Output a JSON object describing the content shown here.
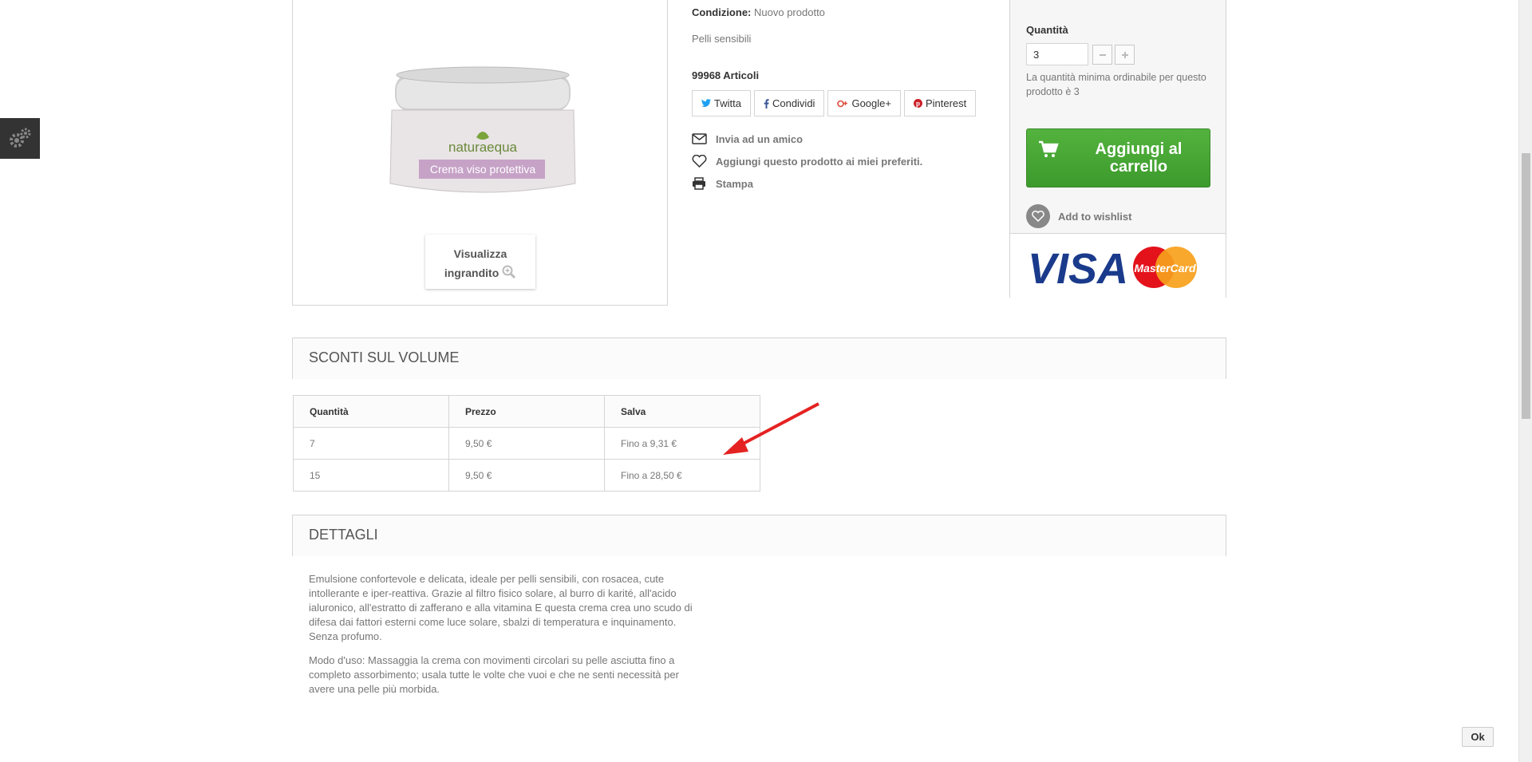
{
  "product": {
    "condition_label": "Condizione:",
    "condition_value": "Nuovo prodotto",
    "skin_type": "Pelli sensibili",
    "stock": "99968 Articoli",
    "jar_brand": "naturaequa",
    "jar_label": "Crema viso protettiva",
    "zoom_label_1": "Visualizza",
    "zoom_label_2": "ingrandito"
  },
  "social": [
    {
      "label": "Twitta",
      "icon": "twitter-icon"
    },
    {
      "label": "Condividi",
      "icon": "facebook-icon"
    },
    {
      "label": "Google+",
      "icon": "google-plus-icon"
    },
    {
      "label": "Pinterest",
      "icon": "pinterest-icon"
    }
  ],
  "links": {
    "send_friend": "Invia ad un amico",
    "favorite": "Aggiungi questo prodotto ai miei preferiti.",
    "print": "Stampa"
  },
  "buybox": {
    "qty_label": "Quantità",
    "qty_value": "3",
    "min_note": "La quantità minima ordinabile per questo prodotto è 3",
    "cart_label": "Aggiungi al carrello",
    "wishlist_label": "Add to wishlist",
    "visa": "VISA",
    "mastercard": "MasterCard"
  },
  "volume": {
    "title": "SCONTI SUL VOLUME",
    "headers": [
      "Quantità",
      "Prezzo",
      "Salva"
    ],
    "rows": [
      [
        "7",
        "9,50 €",
        "Fino a 9,31 €"
      ],
      [
        "15",
        "9,50 €",
        "Fino a 28,50 €"
      ]
    ]
  },
  "details": {
    "title": "DETTAGLI",
    "p1": "Emulsione confortevole e delicata, ideale per pelli sensibili, con rosacea, cute intollerante e iper-reattiva. Grazie al filtro fisico solare, al burro di karité, all'acido ialuronico, all'estratto di zafferano e alla vitamina E questa crema crea uno scudo di difesa dai fattori esterni come luce solare, sbalzi di temperatura e inquinamento. Senza profumo.",
    "p2": "Modo d'uso: Massaggia la crema con movimenti circolari su pelle asciutta fino a completo assorbimento; usala tutte le volte che vuoi e che ne senti necessità per avere una pelle più morbida."
  },
  "cookie": {
    "ok_label": "Ok"
  },
  "colors": {
    "cart_green": "#46a536",
    "arrow_red": "#e52222"
  }
}
